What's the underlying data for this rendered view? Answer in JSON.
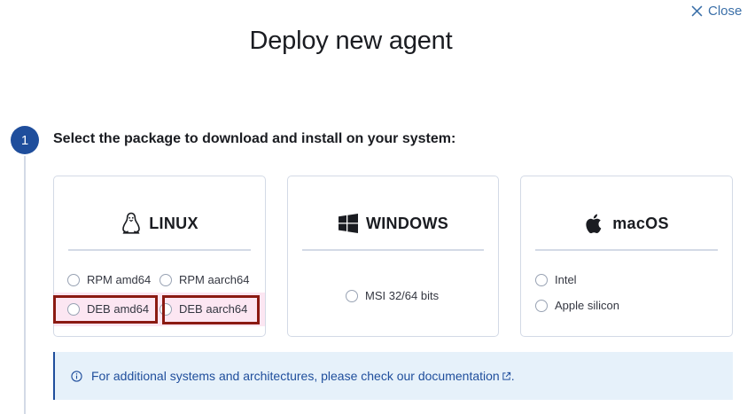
{
  "header": {
    "close_label": "Close",
    "title": "Deploy new agent"
  },
  "step": {
    "number": "1",
    "title": "Select the package to download and install on your system:"
  },
  "cards": {
    "linux": {
      "label": "LINUX",
      "icon": "linux-tux-icon",
      "options": [
        "RPM amd64",
        "RPM aarch64",
        "DEB amd64",
        "DEB aarch64"
      ]
    },
    "windows": {
      "label": "WINDOWS",
      "icon": "windows-logo-icon",
      "options": [
        "MSI 32/64 bits"
      ]
    },
    "macos": {
      "label": "macOS",
      "icon": "apple-logo-icon",
      "options": [
        "Intel",
        "Apple silicon"
      ]
    }
  },
  "callout": {
    "icon": "info-icon",
    "text_before": "For additional systems and architectures, please check our ",
    "link_text": "documentation",
    "text_after": "."
  },
  "colors": {
    "accent": "#1f4e9c",
    "link": "#3a6fa8",
    "highlight": "#8b1a12",
    "callout_bg": "#e6f1fa"
  }
}
